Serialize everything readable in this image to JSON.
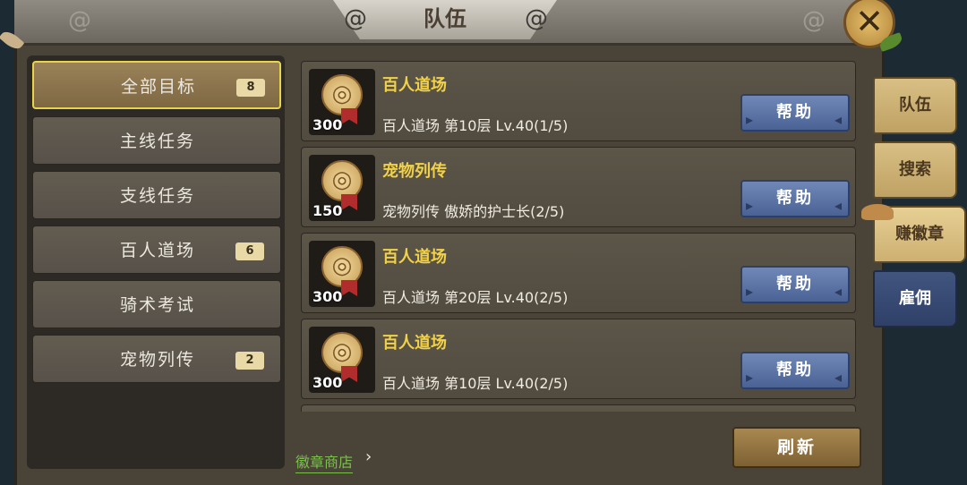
{
  "window": {
    "title": "队伍",
    "close_icon": "close-x-icon"
  },
  "categories": [
    {
      "label": "全部目标",
      "badge": "8",
      "active": true
    },
    {
      "label": "主线任务",
      "badge": ""
    },
    {
      "label": "支线任务",
      "badge": ""
    },
    {
      "label": "百人道场",
      "badge": "6"
    },
    {
      "label": "骑术考试",
      "badge": ""
    },
    {
      "label": "宠物列传",
      "badge": "2"
    }
  ],
  "tasks": [
    {
      "title": "百人道场",
      "desc": "百人道场 第10层 Lv.40(1/5)",
      "count": "300",
      "button": "帮助",
      "icon": "medal-icon"
    },
    {
      "title": "宠物列传",
      "desc": "宠物列传 傲娇的护士长(2/5)",
      "count": "150",
      "button": "帮助",
      "icon": "medal-icon"
    },
    {
      "title": "百人道场",
      "desc": "百人道场 第20层 Lv.40(2/5)",
      "count": "300",
      "button": "帮助",
      "icon": "medal-icon"
    },
    {
      "title": "百人道场",
      "desc": "百人道场 第10层 Lv.40(2/5)",
      "count": "300",
      "button": "帮助",
      "icon": "medal-icon"
    }
  ],
  "footer": {
    "shop_link": "徽章商店",
    "refresh_button": "刷新"
  },
  "right_tabs": [
    {
      "label": "队伍"
    },
    {
      "label": "搜索"
    },
    {
      "label": "赚徽章",
      "active": true
    },
    {
      "label": "雇佣"
    }
  ],
  "colors": {
    "accent_yellow": "#f1d14a",
    "button_blue": "#4a6394",
    "link_green": "#79c14a"
  }
}
